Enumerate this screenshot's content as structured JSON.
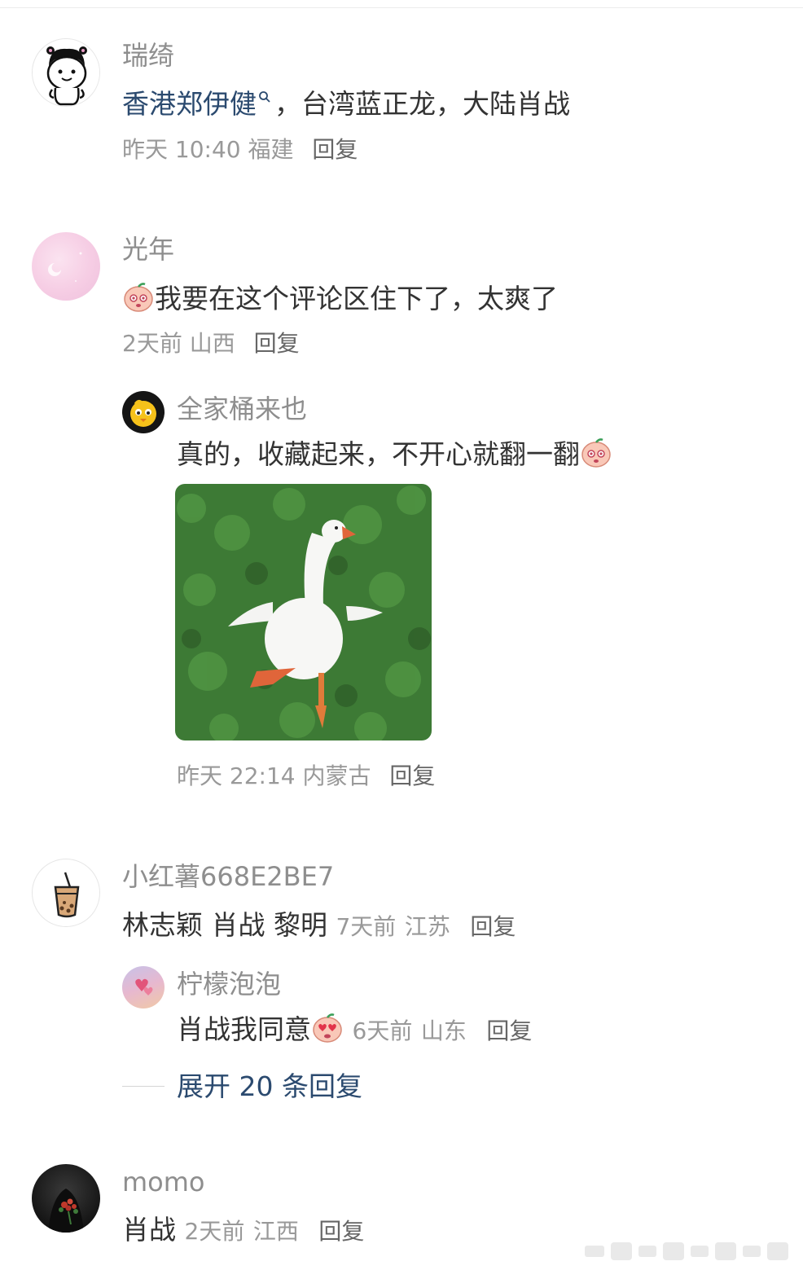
{
  "comments": [
    {
      "username": "瑞绮",
      "avatar": "cartoon-girl-avatar",
      "content_highlight": "香港郑伊健",
      "content_rest": "，台湾蓝正龙，大陆肖战",
      "time": "昨天 10:40",
      "location": "福建",
      "reply_label": "回复"
    },
    {
      "username": "光年",
      "avatar": "pink-gradient-avatar",
      "content_emoji": "peach-face-emoji",
      "content": "我要在这个评论区住下了，太爽了",
      "time": "2天前",
      "location": "山西",
      "reply_label": "回复",
      "reply": {
        "username": "全家桶来也",
        "avatar": "yellow-chick-avatar",
        "content": "真的，收藏起来，不开心就翻一翻",
        "content_emoji": "peach-face-emoji",
        "image": "goose-dancing-photo",
        "time": "昨天 22:14",
        "location": "内蒙古",
        "reply_label": "回复"
      }
    },
    {
      "username": "小红薯668E2BE7",
      "avatar": "bubble-tea-avatar",
      "content": "林志颖 肖战 黎明",
      "time": "7天前",
      "location": "江苏",
      "reply_label": "回复",
      "reply": {
        "username": "柠檬泡泡",
        "avatar": "sunset-heart-avatar",
        "content": "肖战我同意",
        "content_emoji": "heart-eyes-peach-emoji",
        "time": "6天前",
        "location": "山东",
        "reply_label": "回复"
      },
      "expand_label": "展开 20 条回复"
    },
    {
      "username": "momo",
      "avatar": "dark-bouquet-avatar",
      "content": "肖战",
      "time": "2天前",
      "location": "江西",
      "reply_label": "回复"
    }
  ],
  "colors": {
    "username": "#8e8e8e",
    "content": "#333333",
    "link": "#2b4a6f",
    "meta": "#999999"
  }
}
